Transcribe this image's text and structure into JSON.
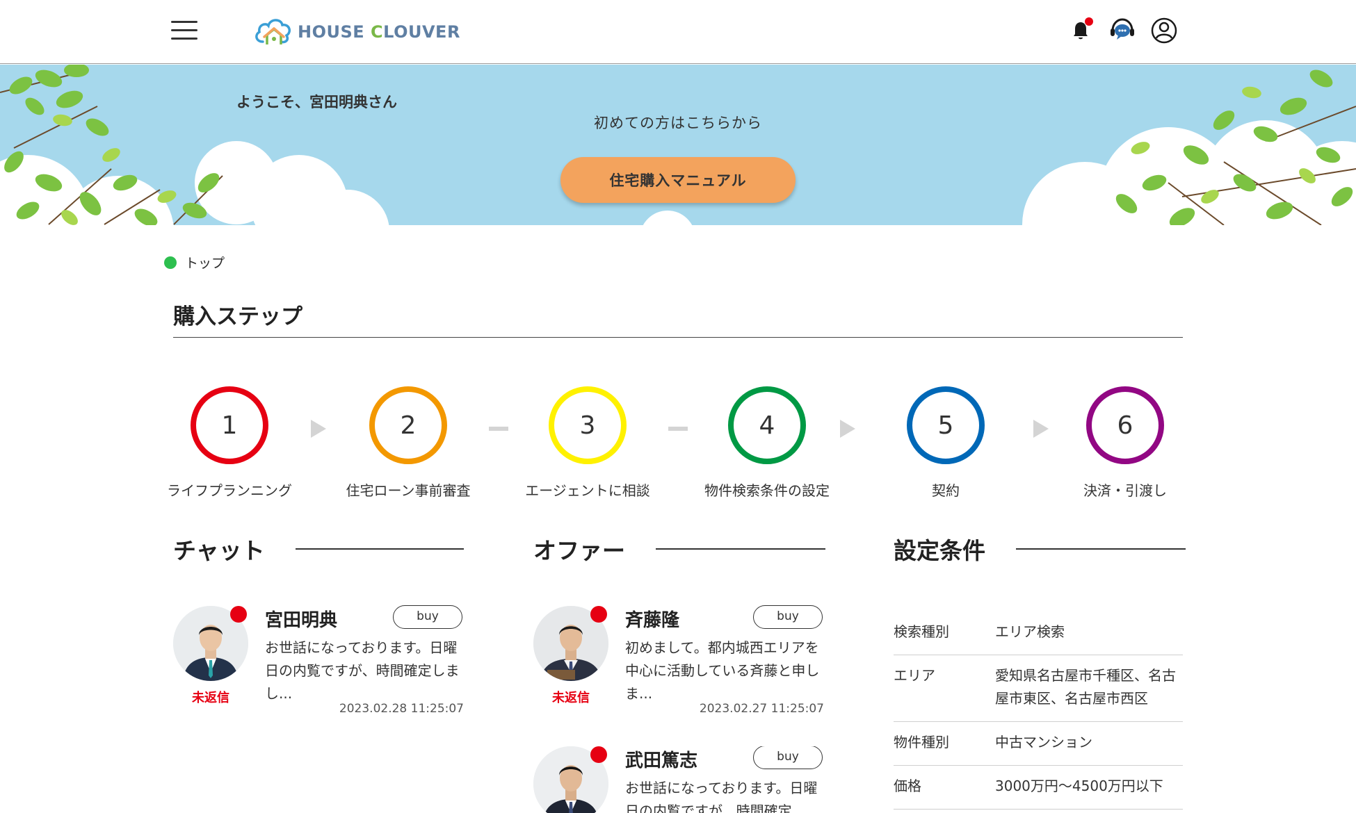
{
  "header": {
    "logo_text_prefix": "HOUSE ",
    "logo_text_c": "C",
    "logo_text_suffix": "LOUVER",
    "icons": [
      "hamburger-menu-icon",
      "bell-icon",
      "chat-support-icon",
      "account-icon"
    ],
    "accent_color": "#5f7fa3",
    "brand_green": "#7ab848"
  },
  "banner": {
    "welcome": "ようこそ、宮田明典さん",
    "first_time": "初めての方はこちらから",
    "manual_button": "住宅購入マニュアル",
    "background_color": "#a6d8ec",
    "button_color": "#f3a35d"
  },
  "breadcrumb": {
    "current": "トップ"
  },
  "purchase_steps": {
    "title": "購入ステップ",
    "steps": [
      {
        "number": "1",
        "label": "ライフプランニング",
        "color": "#e60012"
      },
      {
        "number": "2",
        "label": "住宅ローン事前審査",
        "color": "#f39800"
      },
      {
        "number": "3",
        "label": "エージェントに相談",
        "color": "#fff100"
      },
      {
        "number": "4",
        "label": "物件検索条件の設定",
        "color": "#009944"
      },
      {
        "number": "5",
        "label": "契約",
        "color": "#0068b7"
      },
      {
        "number": "6",
        "label": "決済・引渡し",
        "color": "#920783"
      }
    ],
    "connectors": [
      "arrow",
      "dash",
      "dash",
      "arrow",
      "arrow"
    ]
  },
  "chat": {
    "title": "チャット",
    "items": [
      {
        "name": "宮田明典",
        "badge": "buy",
        "status": "未返信",
        "message": "お世話になっております。日曜日の内覧ですが、時間確定しまし...",
        "date": "2023.02.28 11:25:07"
      }
    ]
  },
  "offer": {
    "title": "オファー",
    "items": [
      {
        "name": "斉藤隆",
        "badge": "buy",
        "status": "未返信",
        "message": "初めまして。都内城西エリアを中心に活動している斉藤と申しま...",
        "date": "2023.02.27 11:25:07"
      },
      {
        "name": "武田篤志",
        "badge": "buy",
        "message": "お世話になっております。日曜日の内覧ですが、時間確定"
      }
    ]
  },
  "conditions": {
    "title": "設定条件",
    "rows": [
      {
        "key": "検索種別",
        "value": "エリア検索"
      },
      {
        "key": "エリア",
        "value": "愛知県名古屋市千種区、名古屋市東区、名古屋市西区"
      },
      {
        "key": "物件種別",
        "value": "中古マンション"
      },
      {
        "key": "価格",
        "value": "3000万円〜4500万円以下"
      }
    ]
  },
  "colors": {
    "unread": "#e60012",
    "breadcrumb_dot": "#2dbf4f"
  }
}
